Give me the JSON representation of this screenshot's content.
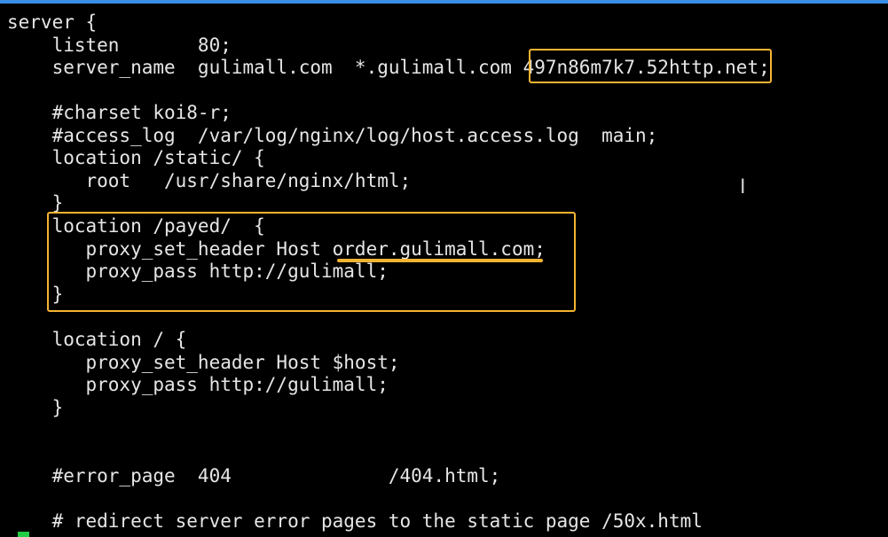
{
  "editor": {
    "lines": [
      "server {",
      "    listen       80;",
      "    server_name  gulimall.com  *.gulimall.com 497n86m7k7.52http.net;",
      "",
      "    #charset koi8-r;",
      "    #access_log  /var/log/nginx/log/host.access.log  main;",
      "    location /static/ {",
      "       root   /usr/share/nginx/html;",
      "    }",
      "    location /payed/  {",
      "       proxy_set_header Host order.gulimall.com;",
      "       proxy_pass http://gulimall;",
      "    }",
      "",
      "    location / {",
      "       proxy_set_header Host $host;",
      "       proxy_pass http://gulimall;",
      "    }",
      "",
      "",
      "    #error_page  404              /404.html;",
      "",
      "    # redirect server error pages to the static page /50x.html"
    ],
    "highlight_color": "#f5b431",
    "cursor_color": "#22cc44",
    "cursor_icon": "text-cursor-icon"
  }
}
